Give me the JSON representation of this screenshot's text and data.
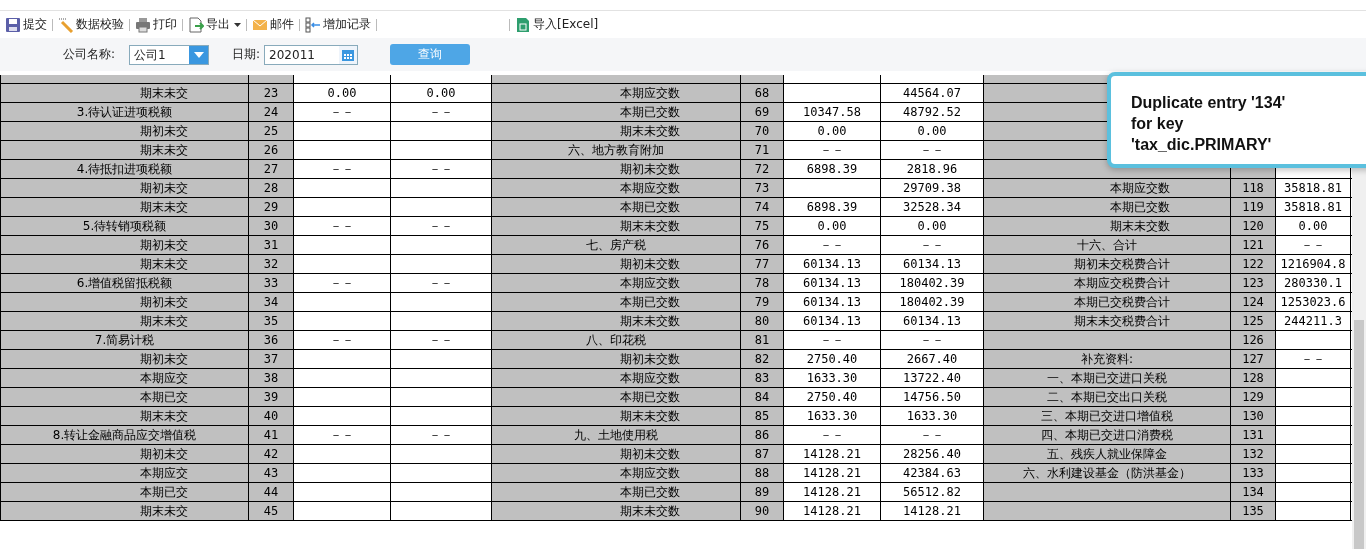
{
  "toolbar": {
    "items": [
      {
        "label": "提交",
        "dropdown": false
      },
      {
        "label": "数据校验",
        "dropdown": false
      },
      {
        "label": "打印",
        "dropdown": false
      },
      {
        "label": "导出",
        "dropdown": true
      },
      {
        "label": "邮件",
        "dropdown": false
      },
      {
        "label": "增加记录",
        "dropdown": false
      }
    ],
    "import_button": {
      "label": "导入[Excel]"
    }
  },
  "filter": {
    "company_label": "公司名称:",
    "company_value": "公司1",
    "date_label": "日期:",
    "date_value": "202011",
    "query_button": "查询"
  },
  "table": {
    "left_rows": [
      {
        "kind": "item",
        "label": "期末未交",
        "no": "23",
        "values": [
          "0.00",
          "0.00"
        ]
      },
      {
        "kind": "section",
        "label": "3.待认证进项税额",
        "no": "24",
        "values": [
          "－－",
          "－－"
        ]
      },
      {
        "kind": "item",
        "label": "期初未交",
        "no": "25"
      },
      {
        "kind": "item",
        "label": "期末未交",
        "no": "26"
      },
      {
        "kind": "section",
        "label": "4.待抵扣进项税额",
        "no": "27",
        "values": [
          "－－",
          "－－"
        ]
      },
      {
        "kind": "item",
        "label": "期初未交",
        "no": "28"
      },
      {
        "kind": "item",
        "label": "期末未交",
        "no": "29"
      },
      {
        "kind": "section",
        "label": "5.待转销项税额",
        "no": "30",
        "values": [
          "－－",
          "－－"
        ]
      },
      {
        "kind": "item",
        "label": "期初未交",
        "no": "31"
      },
      {
        "kind": "item",
        "label": "期末未交",
        "no": "32"
      },
      {
        "kind": "section",
        "label": "6.增值税留抵税额",
        "no": "33",
        "values": [
          "－－",
          "－－"
        ]
      },
      {
        "kind": "item",
        "label": "期初未交",
        "no": "34"
      },
      {
        "kind": "item",
        "label": "期末未交",
        "no": "35"
      },
      {
        "kind": "section",
        "label": "7.简易计税",
        "no": "36",
        "values": [
          "－－",
          "－－"
        ]
      },
      {
        "kind": "item",
        "label": "期初未交",
        "no": "37"
      },
      {
        "kind": "item",
        "label": "本期应交",
        "no": "38"
      },
      {
        "kind": "item",
        "label": "本期已交",
        "no": "39"
      },
      {
        "kind": "item",
        "label": "期末未交",
        "no": "40"
      },
      {
        "kind": "section",
        "label": "8.转让金融商品应交增值税",
        "no": "41",
        "values": [
          "－－",
          "－－"
        ]
      },
      {
        "kind": "item",
        "label": "期初未交",
        "no": "42"
      },
      {
        "kind": "item",
        "label": "本期应交",
        "no": "43"
      },
      {
        "kind": "item",
        "label": "本期已交",
        "no": "44"
      },
      {
        "kind": "item",
        "label": "期末未交",
        "no": "45"
      }
    ],
    "middle_rows": [
      {
        "kind": "item",
        "label": "本期应交数",
        "no": "68",
        "value_2": "44564.07"
      },
      {
        "kind": "item",
        "label": "本期已交数",
        "no": "69",
        "values": [
          "10347.58",
          "48792.52"
        ]
      },
      {
        "kind": "item",
        "label": "期末未交数",
        "no": "70",
        "values": [
          "0.00",
          "0.00"
        ]
      },
      {
        "kind": "section",
        "label": "六、地方教育附加",
        "no": "71",
        "values": [
          "－－",
          "－－"
        ]
      },
      {
        "kind": "item",
        "label": "期初未交数",
        "no": "72",
        "values": [
          "6898.39",
          "2818.96"
        ]
      },
      {
        "kind": "item",
        "label": "本期应交数",
        "no": "73",
        "value_2": "29709.38"
      },
      {
        "kind": "item",
        "label": "本期已交数",
        "no": "74",
        "values": [
          "6898.39",
          "32528.34"
        ]
      },
      {
        "kind": "item",
        "label": "期末未交数",
        "no": "75",
        "values": [
          "0.00",
          "0.00"
        ]
      },
      {
        "kind": "section",
        "label": "七、房产税",
        "no": "76",
        "values": [
          "－－",
          "－－"
        ]
      },
      {
        "kind": "item",
        "label": "期初未交数",
        "no": "77",
        "values": [
          "60134.13",
          "60134.13"
        ]
      },
      {
        "kind": "item",
        "label": "本期应交数",
        "no": "78",
        "values": [
          "60134.13",
          "180402.39"
        ]
      },
      {
        "kind": "item",
        "label": "本期已交数",
        "no": "79",
        "values": [
          "60134.13",
          "180402.39"
        ]
      },
      {
        "kind": "item",
        "label": "期末未交数",
        "no": "80",
        "values": [
          "60134.13",
          "60134.13"
        ]
      },
      {
        "kind": "section",
        "label": "八、印花税",
        "no": "81",
        "values": [
          "－－",
          "－－"
        ]
      },
      {
        "kind": "item",
        "label": "期初未交数",
        "no": "82",
        "values": [
          "2750.40",
          "2667.40"
        ]
      },
      {
        "kind": "item",
        "label": "本期应交数",
        "no": "83",
        "values": [
          "1633.30",
          "13722.40"
        ]
      },
      {
        "kind": "item",
        "label": "本期已交数",
        "no": "84",
        "values": [
          "2750.40",
          "14756.50"
        ]
      },
      {
        "kind": "item",
        "label": "期末未交数",
        "no": "85",
        "values": [
          "1633.30",
          "1633.30"
        ]
      },
      {
        "kind": "section",
        "label": "九、土地使用税",
        "no": "86",
        "values": [
          "－－",
          "－－"
        ]
      },
      {
        "kind": "item",
        "label": "期初未交数",
        "no": "87",
        "values": [
          "14128.21",
          "28256.40"
        ]
      },
      {
        "kind": "item",
        "label": "本期应交数",
        "no": "88",
        "values": [
          "14128.21",
          "42384.63"
        ]
      },
      {
        "kind": "item",
        "label": "本期已交数",
        "no": "89",
        "values": [
          "14128.21",
          "56512.82"
        ]
      },
      {
        "kind": "item",
        "label": "期末未交数",
        "no": "90",
        "values": [
          "14128.21",
          "14128.21"
        ]
      }
    ],
    "right_rows": [
      {
        "kind": "covered"
      },
      {
        "kind": "covered"
      },
      {
        "kind": "covered"
      },
      {
        "kind": "covered"
      },
      {
        "kind": "covered"
      },
      {
        "kind": "item",
        "label": "本期应交数",
        "no": "118",
        "value": "35818.81"
      },
      {
        "kind": "item",
        "label": "本期已交数",
        "no": "119",
        "value": "35818.81"
      },
      {
        "kind": "item",
        "label": "期末未交数",
        "no": "120",
        "value": "0.00"
      },
      {
        "kind": "section",
        "label": "十六、合计",
        "no": "121",
        "value": "－－"
      },
      {
        "kind": "item",
        "label": "期初未交税费合计",
        "no": "122",
        "value": "1216904.8"
      },
      {
        "kind": "item",
        "label": "本期应交税费合计",
        "no": "123",
        "value": "280330.1"
      },
      {
        "kind": "item",
        "label": "本期已交税费合计",
        "no": "124",
        "value": "1253023.6"
      },
      {
        "kind": "item",
        "label": "期末未交税费合计",
        "no": "125",
        "value": "244211.3"
      },
      {
        "kind": "item",
        "no": "126"
      },
      {
        "kind": "section",
        "label": "补充资料:",
        "no": "127",
        "value": "－－"
      },
      {
        "kind": "section",
        "label": "一、本期已交进口关税",
        "no": "128"
      },
      {
        "kind": "section",
        "label": "二、本期已交出口关税",
        "no": "129"
      },
      {
        "kind": "section",
        "label": "三、本期已交进口增值税",
        "no": "130"
      },
      {
        "kind": "section",
        "label": "四、本期已交进口消费税",
        "no": "131"
      },
      {
        "kind": "section",
        "label": "五、残疾人就业保障金",
        "no": "132"
      },
      {
        "kind": "section",
        "label": "六、水利建设基金（防洪基金）",
        "no": "133"
      },
      {
        "kind": "item",
        "no": "134"
      },
      {
        "kind": "item",
        "no": "135"
      }
    ]
  },
  "error_tooltip": {
    "message": "Duplicate entry '134' for key 'tax_dic.PRIMARY'"
  }
}
